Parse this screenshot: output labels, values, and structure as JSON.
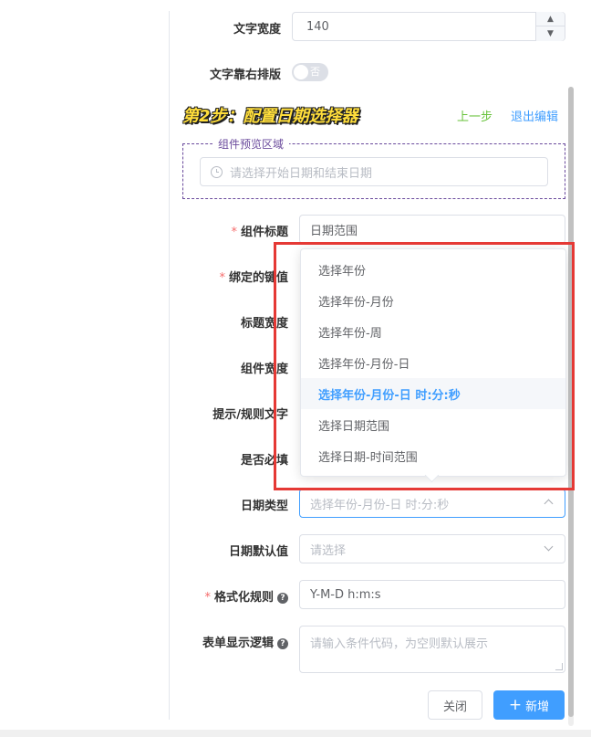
{
  "fields": {
    "text_width": {
      "label": "文字宽度",
      "value": "140"
    },
    "text_right": {
      "label": "文字靠右排版",
      "toggle_text": "否"
    }
  },
  "step": {
    "title": "第2步：配置日期选择器",
    "prev": "上一步",
    "exit": "退出编辑"
  },
  "preview": {
    "legend": "组件预览区域",
    "placeholder": "请选择开始日期和结束日期"
  },
  "form": {
    "component_title": {
      "label": "组件标题",
      "value": "日期范围"
    },
    "bound_key": {
      "label": "绑定的键值"
    },
    "title_width": {
      "label": "标题宽度"
    },
    "component_width": {
      "label": "组件宽度"
    },
    "hint_text": {
      "label": "提示/规则文字"
    },
    "required": {
      "label": "是否必填"
    },
    "date_type": {
      "label": "日期类型",
      "placeholder": "选择年份-月份-日 时:分:秒"
    },
    "default_value": {
      "label": "日期默认值",
      "placeholder": "请选择"
    },
    "format_rule": {
      "label": "格式化规则",
      "value": "Y-M-D h:m:s"
    },
    "display_logic": {
      "label": "表单显示逻辑",
      "placeholder": "请输入条件代码，为空则默认展示"
    }
  },
  "dropdown": {
    "options": [
      "选择年份",
      "选择年份-月份",
      "选择年份-周",
      "选择年份-月份-日",
      "选择年份-月份-日 时:分:秒",
      "选择日期范围",
      "选择日期-时间范围"
    ],
    "selected_index": 4
  },
  "footer": {
    "close": "关闭",
    "add": "新增",
    "add_icon": "+"
  },
  "colors": {
    "primary": "#409eff",
    "required": "#f56c6c",
    "highlight": "#e53935",
    "link_green": "#67c23a"
  }
}
